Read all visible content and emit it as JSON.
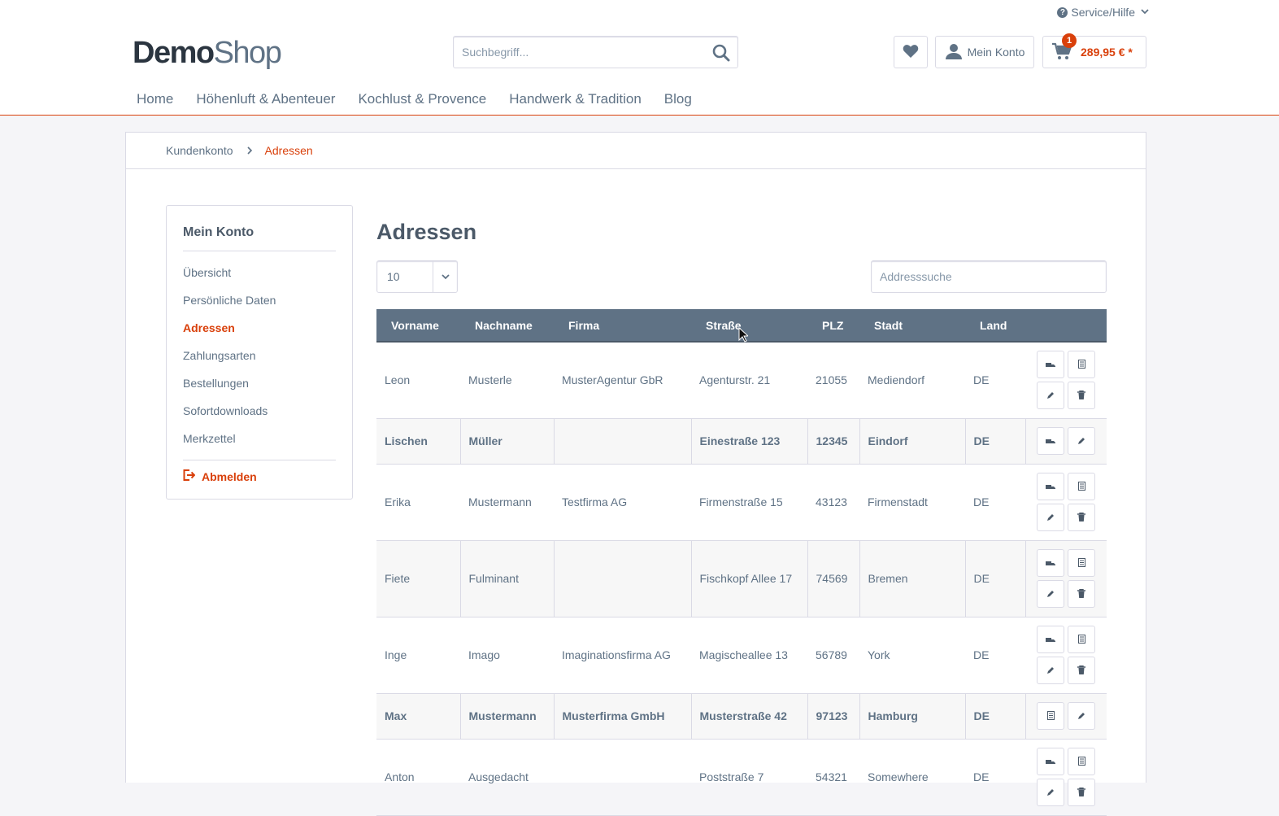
{
  "header": {
    "service_label": "Service/Hilfe",
    "logo_bold": "Demo",
    "logo_light": "Shop",
    "search_placeholder": "Suchbegriff...",
    "account_label": "Mein Konto",
    "cart_count": "1",
    "cart_amount": "289,95 € *"
  },
  "nav": [
    "Home",
    "Höhenluft & Abenteuer",
    "Kochlust & Provence",
    "Handwerk & Tradition",
    "Blog"
  ],
  "breadcrumb": {
    "parent": "Kundenkonto",
    "current": "Adressen"
  },
  "sidebar": {
    "title": "Mein Konto",
    "items": [
      "Übersicht",
      "Persönliche Daten",
      "Adressen",
      "Zahlungsarten",
      "Bestellungen",
      "Sofortdownloads",
      "Merkzettel"
    ],
    "active": "Adressen",
    "logout": "Abmelden"
  },
  "main": {
    "title": "Adressen",
    "per_page": "10",
    "search_placeholder": "Addresssuche",
    "columns": [
      "Vorname",
      "Nachname",
      "Firma",
      "Straße",
      "PLZ",
      "Stadt",
      "Land"
    ],
    "rows": [
      {
        "vorname": "Leon",
        "nachname": "Musterle",
        "firma": "MusterAgentur GbR",
        "strasse": "Agenturstr. 21",
        "plz": "21055",
        "stadt": "Mediendorf",
        "land": "DE"
      },
      {
        "vorname": "Lischen",
        "nachname": "Müller",
        "firma": "",
        "strasse": "Einestraße 123",
        "plz": "12345",
        "stadt": "Eindorf",
        "land": "DE"
      },
      {
        "vorname": "Erika",
        "nachname": "Mustermann",
        "firma": "Testfirma AG",
        "strasse": "Firmenstraße 15",
        "plz": "43123",
        "stadt": "Firmenstadt",
        "land": "DE"
      },
      {
        "vorname": "Fiete",
        "nachname": "Fulminant",
        "firma": "",
        "strasse": "Fischkopf Allee 17",
        "plz": "74569",
        "stadt": "Bremen",
        "land": "DE"
      },
      {
        "vorname": "Inge",
        "nachname": "Imago",
        "firma": "Imaginationsfirma AG",
        "strasse": "Magischeallee 13",
        "plz": "56789",
        "stadt": "York",
        "land": "DE"
      },
      {
        "vorname": "Max",
        "nachname": "Mustermann",
        "firma": "Musterfirma GmbH",
        "strasse": "Musterstraße 42",
        "plz": "97123",
        "stadt": "Hamburg",
        "land": "DE"
      },
      {
        "vorname": "Anton",
        "nachname": "Ausgedacht",
        "firma": "",
        "strasse": "Poststraße 7",
        "plz": "54321",
        "stadt": "Somewhere",
        "land": "DE"
      }
    ]
  },
  "colors": {
    "accent": "#d9400b",
    "table_header": "#5f7285",
    "text": "#5f7285"
  }
}
